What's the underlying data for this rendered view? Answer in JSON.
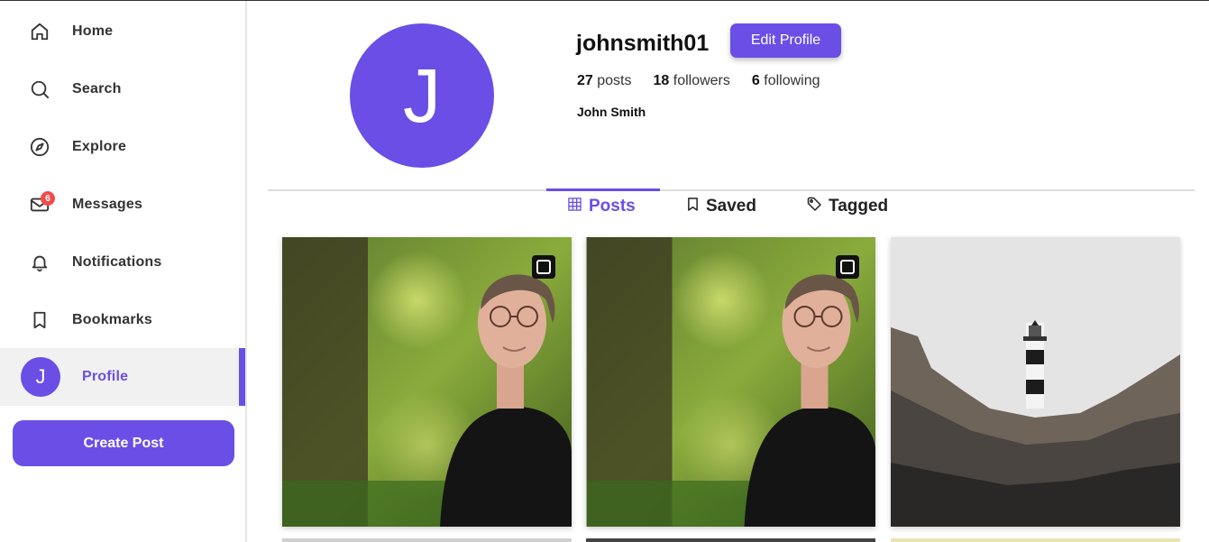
{
  "sidebar": {
    "items": [
      {
        "label": "Home",
        "icon": "home-icon"
      },
      {
        "label": "Search",
        "icon": "search-icon"
      },
      {
        "label": "Explore",
        "icon": "compass-icon"
      },
      {
        "label": "Messages",
        "icon": "mail-icon",
        "badge": "6"
      },
      {
        "label": "Notifications",
        "icon": "bell-icon"
      },
      {
        "label": "Bookmarks",
        "icon": "bookmark-icon"
      },
      {
        "label": "Profile",
        "avatar_letter": "J"
      }
    ],
    "create_post_label": "Create Post"
  },
  "profile": {
    "avatar_letter": "J",
    "username": "johnsmith01",
    "edit_label": "Edit Profile",
    "posts_count": "27",
    "posts_label": "posts",
    "followers_count": "18",
    "followers_label": "followers",
    "following_count": "6",
    "following_label": "following",
    "full_name": "John Smith"
  },
  "tabs": [
    {
      "label": "Posts",
      "icon": "grid-icon",
      "active": true
    },
    {
      "label": "Saved",
      "icon": "bookmark-icon",
      "active": false
    },
    {
      "label": "Tagged",
      "icon": "tag-icon",
      "active": false
    }
  ],
  "posts": [
    {
      "kind": "portrait photo",
      "multi": true
    },
    {
      "kind": "portrait photo",
      "multi": true
    },
    {
      "kind": "lighthouse photo",
      "multi": false
    }
  ],
  "colors": {
    "accent": "#6b4ee6",
    "badge": "#ef4d4d"
  }
}
